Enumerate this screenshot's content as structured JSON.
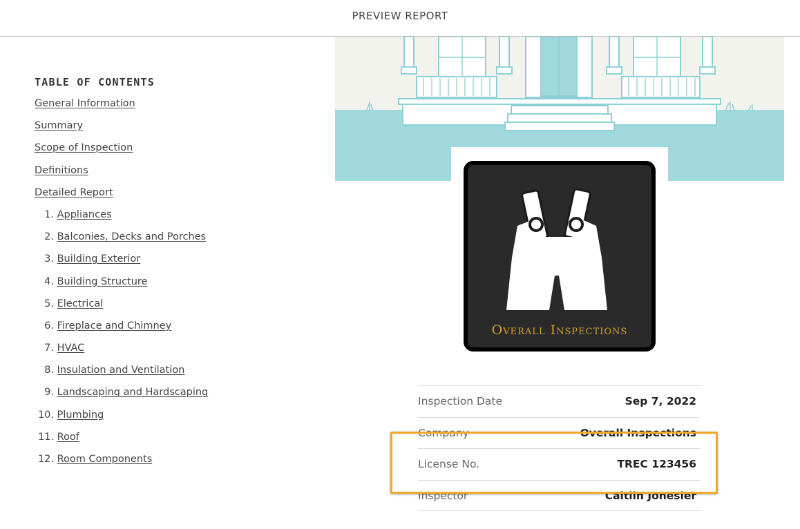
{
  "header": {
    "title": "PREVIEW REPORT"
  },
  "toc": {
    "heading": "TABLE OF CONTENTS",
    "top_links": [
      "General Information",
      "Summary",
      "Scope of Inspection",
      "Definitions",
      "Detailed Report"
    ],
    "sections": [
      {
        "num": "1.",
        "label": "Appliances"
      },
      {
        "num": "2.",
        "label": "Balconies, Decks and Porches"
      },
      {
        "num": "3.",
        "label": "Building Exterior"
      },
      {
        "num": "4.",
        "label": "Building Structure"
      },
      {
        "num": "5.",
        "label": "Electrical"
      },
      {
        "num": "6.",
        "label": "Fireplace and Chimney"
      },
      {
        "num": "7.",
        "label": "HVAC"
      },
      {
        "num": "8.",
        "label": "Insulation and Ventilation"
      },
      {
        "num": "9.",
        "label": "Landscaping and Hardscaping"
      },
      {
        "num": "10.",
        "label": "Plumbing"
      },
      {
        "num": "11.",
        "label": "Roof"
      },
      {
        "num": "12.",
        "label": "Room Components"
      }
    ]
  },
  "logo": {
    "text": "Overall Inspections",
    "text_color": "#d4a02c",
    "icon": "overalls-icon"
  },
  "info": {
    "inspection_date": {
      "label": "Inspection Date",
      "value": "Sep 7, 2022"
    },
    "company": {
      "label": "Company",
      "value": "Overall Inspections"
    },
    "license": {
      "label": "License No.",
      "value": "TREC 123456"
    },
    "inspector": {
      "label": "Inspector",
      "value": "Caitlin Jonesier"
    }
  },
  "colors": {
    "teal": "#a0d9dd",
    "highlight": "#f0a92c"
  }
}
